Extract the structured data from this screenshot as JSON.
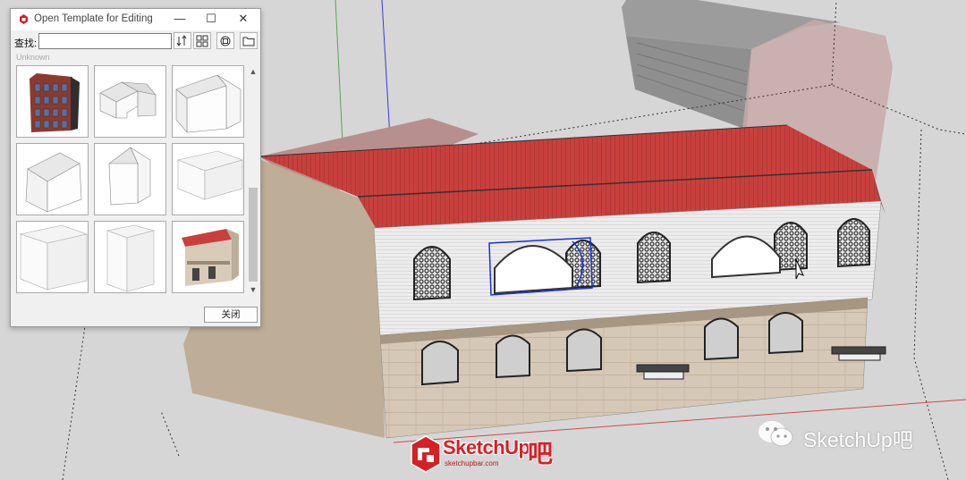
{
  "dialog": {
    "title": "Open Template for Editing",
    "minimize_glyph": "—",
    "maximize_glyph": "☐",
    "close_glyph": "✕",
    "search_label": "查找:",
    "search_value": "",
    "section_label": "Unknown",
    "close_button_label": "关闭",
    "tool_icons": [
      "sort-icon",
      "grid-view-icon",
      "refresh-icon",
      "open-folder-icon"
    ],
    "templates": [
      "building-facade-thumbnail",
      "gable-house-thumbnail",
      "gable-box-thumbnail",
      "gable-box-thumbnail",
      "gable-box-thumbnail",
      "flat-box-thumbnail",
      "flat-box-thumbnail",
      "flat-box-thumbnail",
      "building-model-thumbnail"
    ]
  },
  "watermarks": {
    "wechat_text": "SketchUp吧",
    "logo_text": "SketchUp",
    "logo_suffix": "吧",
    "logo_url": "sketchupbar.com"
  },
  "colors": {
    "roof_red": "#c8403d",
    "wall_white": "#ececec",
    "base_beige": "#cdbfae",
    "side_beige": "#bfae97",
    "selection_blue": "#1a2fd6",
    "axis_blue": "#3a3ad8",
    "axis_red": "#d24a4a",
    "brand_red": "#d61f26"
  }
}
